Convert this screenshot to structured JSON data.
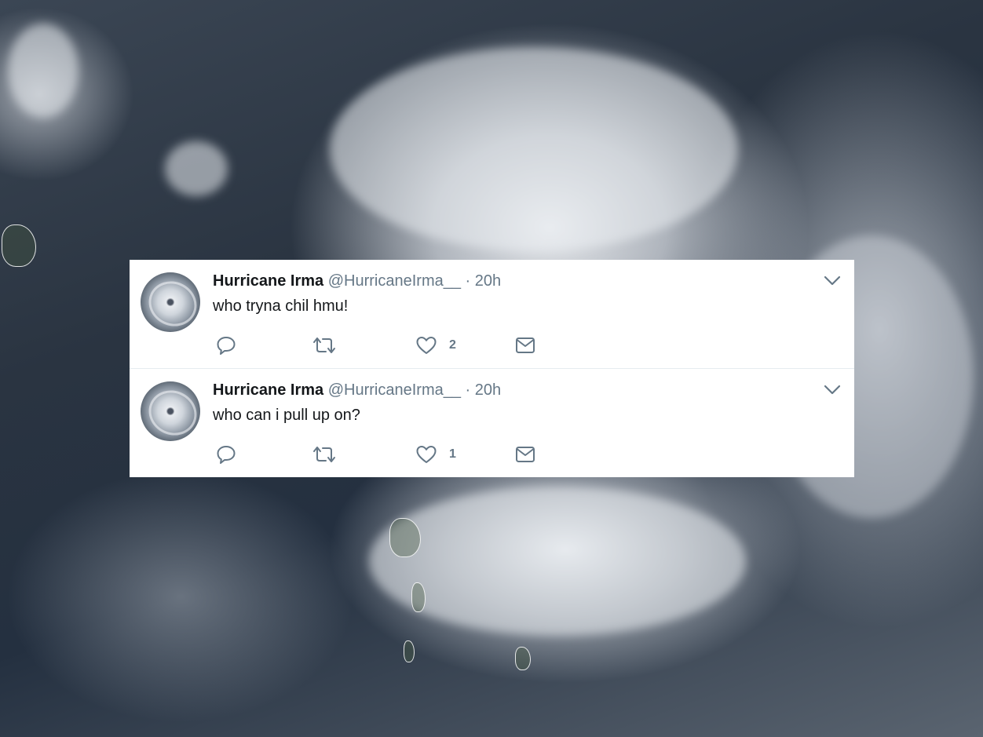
{
  "tweets": [
    {
      "name": "Hurricane Irma",
      "handle": "@HurricaneIrma__",
      "separator": "·",
      "time": "20h",
      "text": "who tryna chil hmu!",
      "like_count": "2",
      "icons": [
        "reply-icon",
        "retweet-icon",
        "like-icon",
        "direct-message-icon",
        "chevron-down-icon"
      ]
    },
    {
      "name": "Hurricane Irma",
      "handle": "@HurricaneIrma__",
      "separator": "·",
      "time": "20h",
      "text": "who can i pull up on?",
      "like_count": "1",
      "icons": [
        "reply-icon",
        "retweet-icon",
        "like-icon",
        "direct-message-icon",
        "chevron-down-icon"
      ]
    }
  ],
  "colors": {
    "text_primary": "#14171a",
    "text_secondary": "#657786",
    "icon": "#657786",
    "divider": "#e6ecf0",
    "card_background": "#ffffff"
  }
}
